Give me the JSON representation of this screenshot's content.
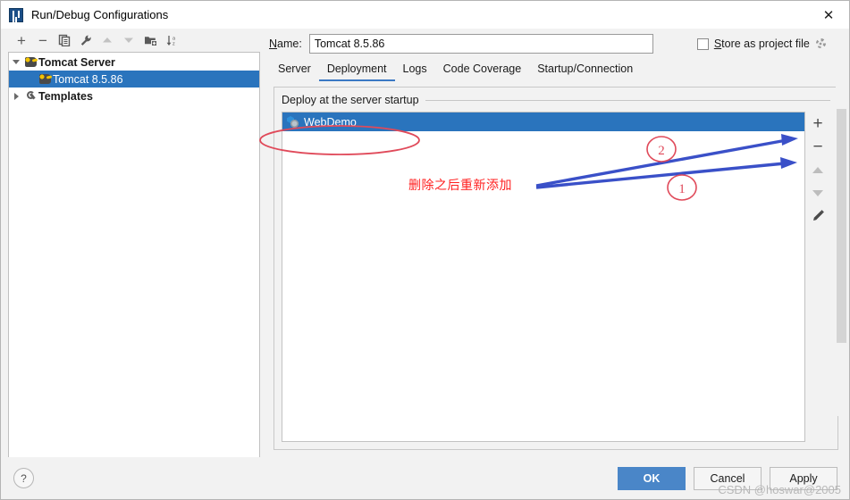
{
  "window": {
    "title": "Run/Debug Configurations",
    "app_icon": "intellij-idea-icon",
    "close_label": "✕"
  },
  "left_pane": {
    "toolbar": [
      {
        "name": "add-configuration-button",
        "glyph": "+",
        "enabled": true
      },
      {
        "name": "remove-configuration-button",
        "glyph": "−",
        "enabled": true
      },
      {
        "name": "copy-configuration-button",
        "glyph": "copy-icon",
        "enabled": true
      },
      {
        "name": "edit-templates-button",
        "glyph": "wrench-icon",
        "enabled": true
      },
      {
        "name": "move-up-button",
        "glyph": "triangle-up-icon",
        "enabled": false
      },
      {
        "name": "move-down-button",
        "glyph": "triangle-down-icon",
        "enabled": false
      },
      {
        "name": "new-folder-button",
        "glyph": "folder-plus-icon",
        "enabled": true
      },
      {
        "name": "sort-configurations-button",
        "glyph": "sort-az-icon",
        "enabled": true
      }
    ],
    "tree": [
      {
        "label": "Tomcat Server",
        "icon": "tomcat-icon",
        "expanded": true,
        "bold": true,
        "selected": false,
        "indent": 0
      },
      {
        "label": "Tomcat 8.5.86",
        "icon": "tomcat-icon",
        "expanded": null,
        "bold": false,
        "selected": true,
        "indent": 1
      },
      {
        "label": "Templates",
        "icon": "wrench-icon",
        "expanded": false,
        "bold": true,
        "selected": false,
        "indent": 0
      }
    ]
  },
  "right_pane": {
    "name_label": "Name:",
    "name_label_mnemonic": "N",
    "name_value": "Tomcat 8.5.86",
    "name_placeholder": "Name",
    "store_as_project_file": {
      "label": "Store as project file",
      "mnemonic": "S",
      "checked": false,
      "gear_icon": "gear-icon"
    },
    "tabs": [
      {
        "label": "Server",
        "active": false
      },
      {
        "label": "Deployment",
        "active": true
      },
      {
        "label": "Logs",
        "active": false
      },
      {
        "label": "Code Coverage",
        "active": false
      },
      {
        "label": "Startup/Connection",
        "active": false
      }
    ],
    "deployment": {
      "group_title": "Deploy at the server startup",
      "rows": [
        {
          "label": "WebDemo",
          "icon": "artifact-icon",
          "selected": true
        }
      ],
      "side_tools": [
        {
          "name": "add-artifact-button",
          "glyph": "+",
          "enabled": true
        },
        {
          "name": "remove-artifact-button",
          "glyph": "−",
          "enabled": true
        },
        {
          "name": "move-artifact-up-button",
          "glyph": "triangle-up-icon",
          "enabled": false
        },
        {
          "name": "move-artifact-down-button",
          "glyph": "triangle-down-icon",
          "enabled": false
        },
        {
          "name": "edit-artifact-button",
          "glyph": "pencil-icon",
          "enabled": true
        }
      ]
    }
  },
  "footer": {
    "help_label": "?",
    "ok_label": "OK",
    "cancel_label": "Cancel",
    "apply_label": "Apply"
  },
  "annotations": {
    "note_text": "删除之后重新添加",
    "marker_one": "1",
    "marker_two": "2",
    "note_color": "#ff2020",
    "arrow_color": "#3a50c8",
    "ellipse_color": "#e04a5a"
  },
  "watermark": {
    "text": "CSDN @hoswar@2005"
  }
}
